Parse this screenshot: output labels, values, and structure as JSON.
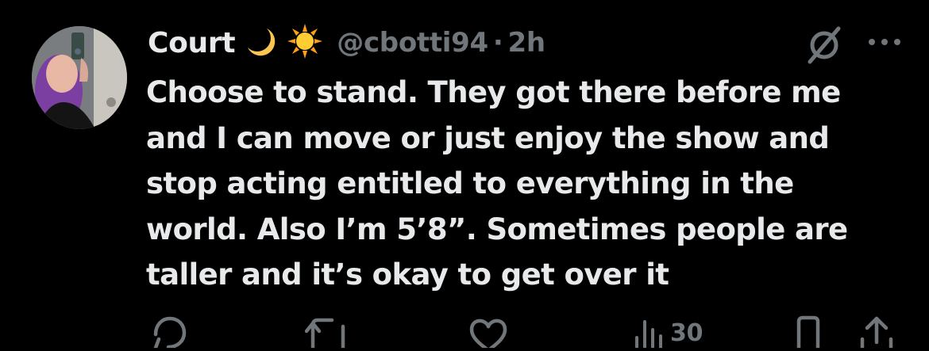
{
  "tweet": {
    "display_name": "Court",
    "name_emojis": [
      "crescent-moon-emoji",
      "sun-emoji"
    ],
    "handle": "@cbotti94",
    "separator": "·",
    "time": "2h",
    "text": "Choose to stand. They got there before me\nand I can move or just enjoy the show and\nstop acting entitled to everything in the\nworld. Also I’m 5’8”. Sometimes people are\ntaller and it’s okay to get over it"
  },
  "actions": {
    "views_count": "30"
  },
  "colors": {
    "background": "#000000",
    "primary_text": "#e7e9ea",
    "secondary_text": "#71767b",
    "moon": "#f9c74f",
    "sun": "#ffcc33"
  },
  "icons": [
    "grok-icon",
    "more-icon",
    "reply-icon",
    "retweet-icon",
    "like-icon",
    "views-icon",
    "bookmark-icon",
    "share-icon"
  ]
}
